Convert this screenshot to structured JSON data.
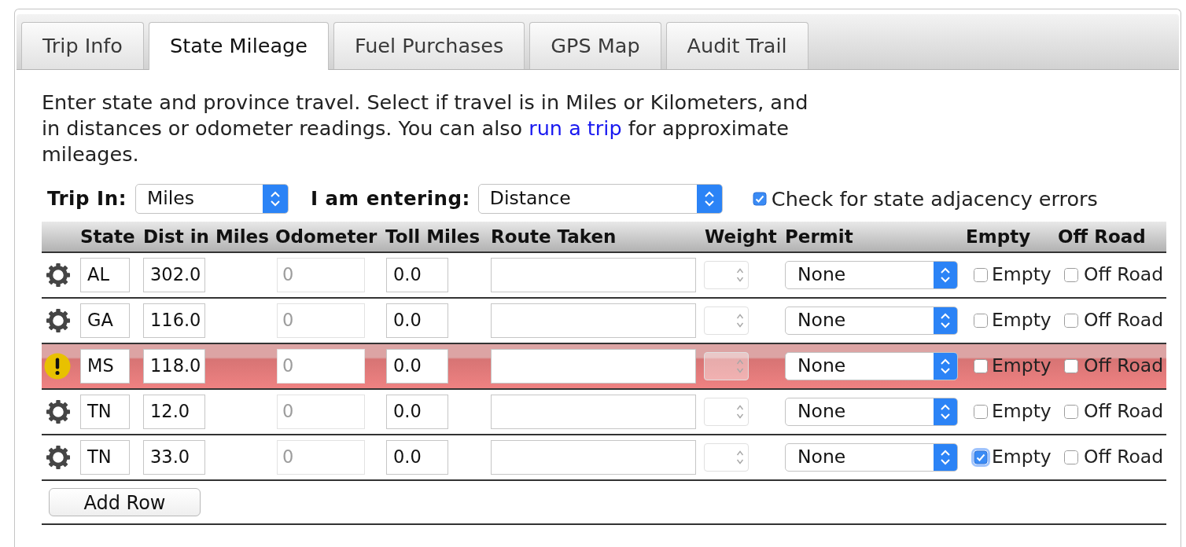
{
  "tabs": [
    {
      "label": "Trip Info",
      "selected": false
    },
    {
      "label": "State Mileage",
      "selected": true
    },
    {
      "label": "Fuel Purchases",
      "selected": false
    },
    {
      "label": "GPS Map",
      "selected": false
    },
    {
      "label": "Audit Trail",
      "selected": false
    }
  ],
  "instructions": {
    "text": "Enter state and province travel. Select if travel is in Miles or Kilometers, and in distances or odometer readings. You can also ",
    "link": "run a trip",
    "text_end": " for approximate mileages."
  },
  "options": {
    "trip_in": {
      "label": "Trip In:",
      "value": "Miles"
    },
    "entering": {
      "label": "I am entering:",
      "value": "Distance"
    },
    "adjacency_check": {
      "label": "Check for state adjacency errors",
      "checked": true
    }
  },
  "table": {
    "columns": [
      "State",
      "Dist in Miles",
      "Odometer",
      "Toll Miles",
      "Route Taken",
      "Weight",
      "Permit",
      "Empty",
      "Off Road"
    ],
    "rows": [
      {
        "error": false,
        "state": "AL",
        "distance": "302.0",
        "odometer": {
          "value": "0",
          "disabled": true
        },
        "toll_miles": "0.0",
        "weight": {
          "disabled": true
        },
        "permit": "None",
        "empty": {
          "label": "Empty",
          "checked": false,
          "focused": false
        },
        "off_road": {
          "label": "Off Road",
          "checked": false
        }
      },
      {
        "error": false,
        "state": "GA",
        "distance": "116.0",
        "odometer": {
          "value": "0",
          "disabled": true
        },
        "toll_miles": "0.0",
        "weight": {
          "disabled": true
        },
        "permit": "None",
        "empty": {
          "label": "Empty",
          "checked": false,
          "focused": false
        },
        "off_road": {
          "label": "Off Road",
          "checked": false
        }
      },
      {
        "error": true,
        "state": "MS",
        "distance": "118.0",
        "odometer": {
          "value": "0",
          "disabled": true
        },
        "toll_miles": "0.0",
        "weight": {
          "disabled": true
        },
        "permit": "None",
        "empty": {
          "label": "Empty",
          "checked": false,
          "focused": false
        },
        "off_road": {
          "label": "Off Road",
          "checked": false
        }
      },
      {
        "error": false,
        "state": "TN",
        "distance": "12.0",
        "odometer": {
          "value": "0",
          "disabled": true
        },
        "toll_miles": "0.0",
        "weight": {
          "disabled": true
        },
        "permit": "None",
        "empty": {
          "label": "Empty",
          "checked": false,
          "focused": false
        },
        "off_road": {
          "label": "Off Road",
          "checked": false
        }
      },
      {
        "error": false,
        "state": "TN",
        "distance": "33.0",
        "odometer": {
          "value": "0",
          "disabled": true
        },
        "toll_miles": "0.0",
        "weight": {
          "disabled": true
        },
        "permit": "None",
        "empty": {
          "label": "Empty",
          "checked": true,
          "focused": true
        },
        "off_road": {
          "label": "Off Road",
          "checked": false
        }
      }
    ]
  },
  "add_row_button": {
    "label": "Add Row"
  }
}
